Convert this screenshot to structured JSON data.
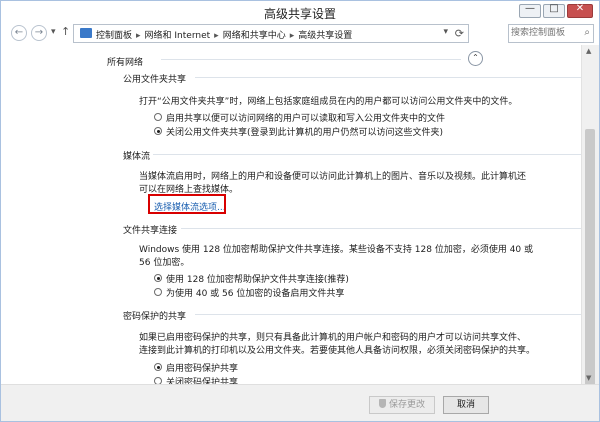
{
  "window": {
    "title": "高级共享设置",
    "controls": {
      "minimize": "—",
      "maximize": "□",
      "close": "✕"
    }
  },
  "nav": {
    "back": "←",
    "forward": "→",
    "recent": "▾",
    "up": "↑",
    "breadcrumbs": [
      "控制面板",
      "网络和 Internet",
      "网络和共享中心",
      "高级共享设置"
    ],
    "separator": "▸",
    "dropdown": "▾",
    "refresh": "⟳",
    "search_placeholder": "搜索控制面板",
    "search_icon": "⌕"
  },
  "main": {
    "section_title": "所有网络",
    "collapse_glyph": "⌃",
    "public_folder": {
      "title": "公用文件夹共享",
      "description": "打开“公用文件夹共享”时，网络上包括家庭组成员在内的用户都可以访问公用文件夹中的文件。",
      "options": [
        {
          "label": "启用共享以便可以访问网络的用户可以读取和写入公用文件夹中的文件",
          "checked": false
        },
        {
          "label": "关闭公用文件夹共享(登录到此计算机的用户仍然可以访问这些文件夹)",
          "checked": true
        }
      ]
    },
    "media_stream": {
      "title": "媒体流",
      "description_line1": "当媒体流启用时，网络上的用户和设备便可以访问此计算机上的图片、音乐以及视频。此计算机还",
      "description_line2": "可以在网络上查找媒体。",
      "link": "选择媒体流选项..."
    },
    "file_sharing": {
      "title": "文件共享连接",
      "description_line1": "Windows 使用 128 位加密帮助保护文件共享连接。某些设备不支持 128 位加密，必须使用 40 或",
      "description_line2": "56 位加密。",
      "options": [
        {
          "label": "使用 128 位加密帮助保护文件共享连接(推荐)",
          "checked": true
        },
        {
          "label": "为使用 40 或 56 位加密的设备启用文件共享",
          "checked": false
        }
      ]
    },
    "password_protected": {
      "title": "密码保护的共享",
      "description_line1": "如果已启用密码保护的共享，则只有具备此计算机的用户帐户和密码的用户才可以访问共享文件、",
      "description_line2": "连接到此计算机的打印机以及公用文件夹。若要使其他人具备访问权限，必须关闭密码保护的共享。",
      "options": [
        {
          "label": "启用密码保护共享",
          "checked": true
        },
        {
          "label": "关闭密码保护共享",
          "checked": false
        }
      ]
    }
  },
  "scrollbar": {
    "up": "▲",
    "down": "▼"
  },
  "footer": {
    "save_label": "保存更改",
    "cancel_label": "取消"
  },
  "colors": {
    "link": "#1b5fb0",
    "highlight_box": "#d80000",
    "close_button": "#c75050"
  }
}
